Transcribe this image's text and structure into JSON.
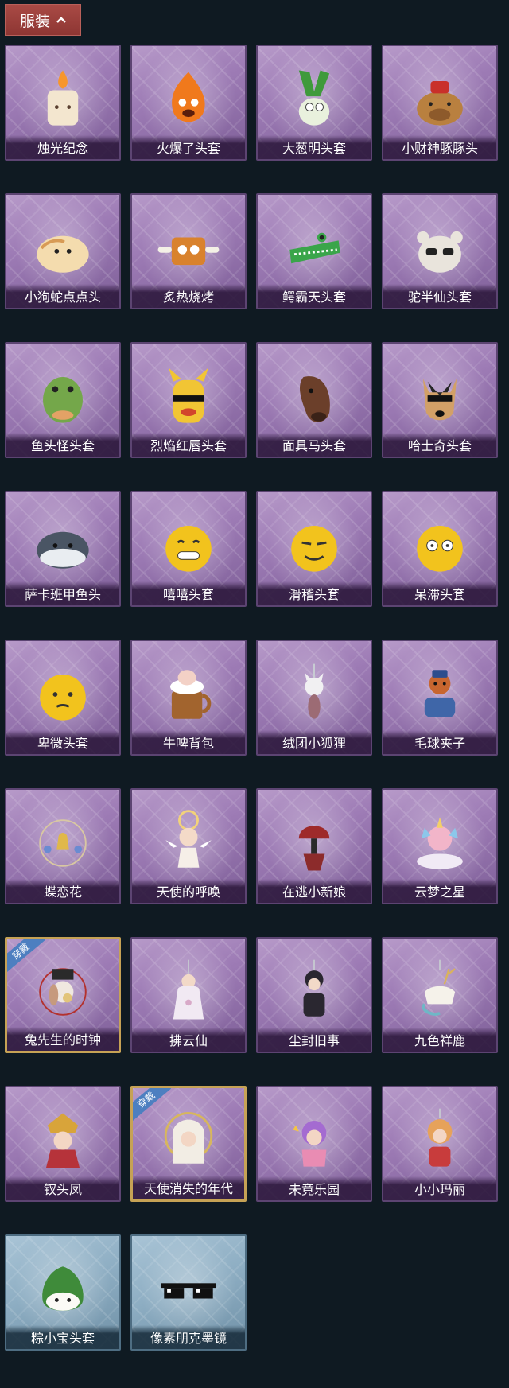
{
  "header": {
    "label": "服装",
    "icon": "chevron-up-icon"
  },
  "equipped_badge": "穿戴",
  "items": [
    {
      "label": "烛光纪念",
      "icon": "candle-head-icon",
      "theme": "purple"
    },
    {
      "label": "火爆了头套",
      "icon": "fire-head-icon",
      "theme": "purple"
    },
    {
      "label": "大葱明头套",
      "icon": "scallion-head-icon",
      "theme": "purple"
    },
    {
      "label": "小财神豚豚头",
      "icon": "capybara-head-icon",
      "theme": "purple"
    },
    {
      "label": "小狗蛇点点头",
      "icon": "snake-head-icon",
      "theme": "purple"
    },
    {
      "label": "炙热烧烤",
      "icon": "grill-meat-icon",
      "theme": "purple"
    },
    {
      "label": "鳄霸天头套",
      "icon": "crocodile-head-icon",
      "theme": "purple"
    },
    {
      "label": "驼半仙头套",
      "icon": "bear-head-icon",
      "theme": "purple"
    },
    {
      "label": "鱼头怪头套",
      "icon": "fish-head-icon",
      "theme": "purple"
    },
    {
      "label": "烈焰红唇头套",
      "icon": "yellow-mask-icon",
      "theme": "purple"
    },
    {
      "label": "面具马头套",
      "icon": "horse-head-icon",
      "theme": "purple"
    },
    {
      "label": "哈士奇头套",
      "icon": "husky-head-icon",
      "theme": "purple"
    },
    {
      "label": "萨卡班甲鱼头",
      "icon": "sacabambaspis-icon",
      "theme": "purple"
    },
    {
      "label": "嘻嘻头套",
      "icon": "grin-emoji-icon",
      "theme": "purple"
    },
    {
      "label": "滑稽头套",
      "icon": "funny-emoji-icon",
      "theme": "purple"
    },
    {
      "label": "呆滞头套",
      "icon": "dazed-emoji-icon",
      "theme": "purple"
    },
    {
      "label": "卑微头套",
      "icon": "humble-emoji-icon",
      "theme": "purple"
    },
    {
      "label": "牛啤背包",
      "icon": "beer-mug-icon",
      "theme": "purple"
    },
    {
      "label": "绒团小狐狸",
      "icon": "fox-charm-icon",
      "theme": "purple"
    },
    {
      "label": "毛球夹子",
      "icon": "raccoon-clip-icon",
      "theme": "purple"
    },
    {
      "label": "蝶恋花",
      "icon": "bell-ornament-icon",
      "theme": "purple"
    },
    {
      "label": "天使的呼唤",
      "icon": "angel-doll-icon",
      "theme": "purple"
    },
    {
      "label": "在逃小新娘",
      "icon": "bride-lamp-icon",
      "theme": "purple"
    },
    {
      "label": "云梦之星",
      "icon": "unicorn-icon",
      "theme": "purple"
    },
    {
      "label": "兔先生的时钟",
      "icon": "rabbit-clock-icon",
      "theme": "purple",
      "equipped": true
    },
    {
      "label": "拂云仙",
      "icon": "fairy-charm-icon",
      "theme": "purple"
    },
    {
      "label": "尘封旧事",
      "icon": "boy-charm-icon",
      "theme": "purple"
    },
    {
      "label": "九色祥鹿",
      "icon": "deer-charm-icon",
      "theme": "purple"
    },
    {
      "label": "钗头凤",
      "icon": "phoenix-doll-icon",
      "theme": "purple"
    },
    {
      "label": "天使消失的年代",
      "icon": "veiled-angel-icon",
      "theme": "purple",
      "equipped": true
    },
    {
      "label": "未竟乐园",
      "icon": "clown-doll-icon",
      "theme": "purple"
    },
    {
      "label": "小小玛丽",
      "icon": "mary-doll-icon",
      "theme": "purple"
    },
    {
      "label": "粽小宝头套",
      "icon": "zongzi-head-icon",
      "theme": "blue"
    },
    {
      "label": "像素朋克墨镜",
      "icon": "pixel-sunglasses-icon",
      "theme": "blue"
    }
  ]
}
